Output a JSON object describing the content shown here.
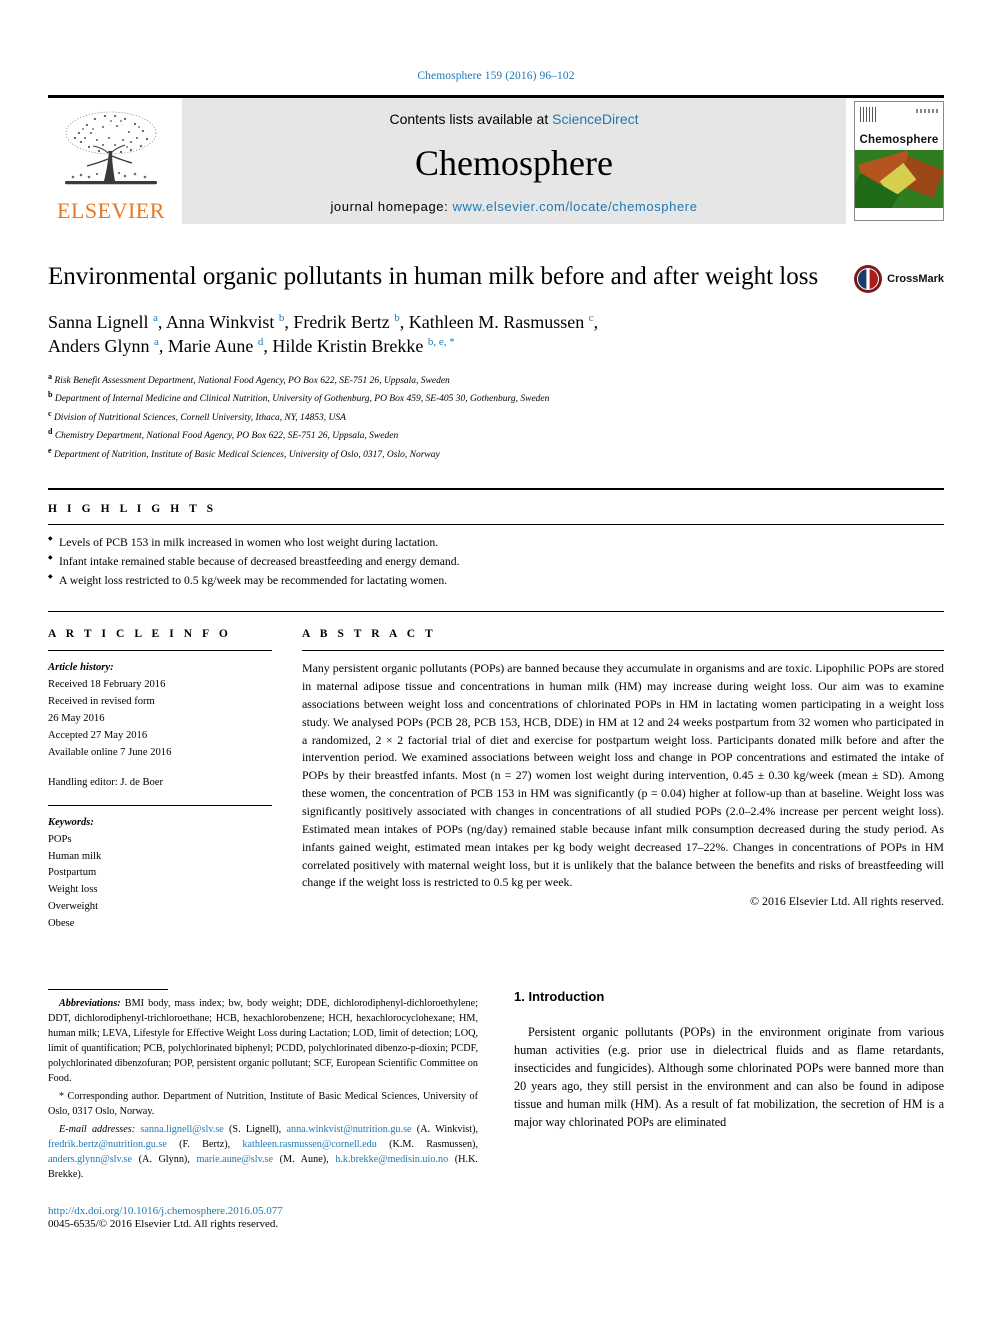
{
  "running_head": "Chemosphere 159 (2016) 96–102",
  "masthead": {
    "publisher": "ELSEVIER",
    "contents_prefix": "Contents lists available at ",
    "contents_link": "ScienceDirect",
    "journal_title": "Chemosphere",
    "homepage_prefix": "journal homepage: ",
    "homepage_url": "www.elsevier.com/locate/chemosphere",
    "cover_journal_name": "Chemosphere"
  },
  "article": {
    "title": "Environmental organic pollutants in human milk before and after weight loss",
    "crossmark_label": "CrossMark",
    "authors_line1": "Sanna Lignell a, Anna Winkvist b, Fredrik Bertz b, Kathleen M. Rasmussen c,",
    "authors_line2": "Anders Glynn a, Marie Aune d, Hilde Kristin Brekke b, e, *",
    "authors": [
      {
        "name": "Sanna Lignell",
        "marks": "a",
        "sep": ", "
      },
      {
        "name": "Anna Winkvist",
        "marks": "b",
        "sep": ", "
      },
      {
        "name": "Fredrik Bertz",
        "marks": "b",
        "sep": ", "
      },
      {
        "name": "Kathleen M. Rasmussen",
        "marks": "c",
        "sep": ","
      },
      {
        "name": "Anders Glynn",
        "marks": "a",
        "sep": ", "
      },
      {
        "name": "Marie Aune",
        "marks": "d",
        "sep": ", "
      },
      {
        "name": "Hilde Kristin Brekke",
        "marks": "b, e, *",
        "sep": ""
      }
    ],
    "affiliations": [
      {
        "mark": "a",
        "text": "Risk Benefit Assessment Department, National Food Agency, PO Box 622, SE-751 26, Uppsala, Sweden"
      },
      {
        "mark": "b",
        "text": "Department of Internal Medicine and Clinical Nutrition, University of Gothenburg, PO Box 459, SE-405 30, Gothenburg, Sweden"
      },
      {
        "mark": "c",
        "text": "Division of Nutritional Sciences, Cornell University, Ithaca, NY, 14853, USA"
      },
      {
        "mark": "d",
        "text": "Chemistry Department, National Food Agency, PO Box 622, SE-751 26, Uppsala, Sweden"
      },
      {
        "mark": "e",
        "text": "Department of Nutrition, Institute of Basic Medical Sciences, University of Oslo, 0317, Oslo, Norway"
      }
    ]
  },
  "highlights": {
    "heading": "H I G H L I G H T S",
    "items": [
      "Levels of PCB 153 in milk increased in women who lost weight during lactation.",
      "Infant intake remained stable because of decreased breastfeeding and energy demand.",
      "A weight loss restricted to 0.5 kg/week may be recommended for lactating women."
    ]
  },
  "article_info": {
    "heading": "A R T I C L E  I N F O",
    "history_label": "Article history:",
    "history": [
      "Received 18 February 2016",
      "Received in revised form",
      "26 May 2016",
      "Accepted 27 May 2016",
      "Available online 7 June 2016"
    ],
    "handling_editor": "Handling editor: J. de Boer",
    "keywords_label": "Keywords:",
    "keywords": [
      "POPs",
      "Human milk",
      "Postpartum",
      "Weight loss",
      "Overweight",
      "Obese"
    ]
  },
  "abstract": {
    "heading": "A B S T R A C T",
    "body": "Many persistent organic pollutants (POPs) are banned because they accumulate in organisms and are toxic. Lipophilic POPs are stored in maternal adipose tissue and concentrations in human milk (HM) may increase during weight loss. Our aim was to examine associations between weight loss and concentrations of chlorinated POPs in HM in lactating women participating in a weight loss study. We analysed POPs (PCB 28, PCB 153, HCB, DDE) in HM at 12 and 24 weeks postpartum from 32 women who participated in a randomized, 2 × 2 factorial trial of diet and exercise for postpartum weight loss. Participants donated milk before and after the intervention period. We examined associations between weight loss and change in POP concentrations and estimated the intake of POPs by their breastfed infants. Most (n = 27) women lost weight during intervention, 0.45 ± 0.30 kg/week (mean ± SD). Among these women, the concentration of PCB 153 in HM was significantly (p = 0.04) higher at follow-up than at baseline. Weight loss was significantly positively associated with changes in concentrations of all studied POPs (2.0–2.4% increase per percent weight loss). Estimated mean intakes of POPs (ng/day) remained stable because infant milk consumption decreased during the study period. As infants gained weight, estimated mean intakes per kg body weight decreased 17–22%. Changes in concentrations of POPs in HM correlated positively with maternal weight loss, but it is unlikely that the balance between the benefits and risks of breastfeeding will change if the weight loss is restricted to 0.5 kg per week.",
    "copyright": "© 2016 Elsevier Ltd. All rights reserved."
  },
  "footnotes": {
    "abbreviations_label": "Abbreviations:",
    "abbreviations_text": " BMI body, mass index; bw, body weight; DDE, dichlorodiphenyl-dichloroethylene; DDT, dichlorodiphenyl-trichloroethane; HCB, hexachlorobenzene; HCH, hexachlorocyclohexane; HM, human milk; LEVA, Lifestyle for Effective Weight Loss during Lactation; LOD, limit of detection; LOQ, limit of quantification; PCB, polychlorinated biphenyl; PCDD, polychlorinated dibenzo-p-dioxin; PCDF, polychlorinated dibenzofuran; POP, persistent organic pollutant; SCF, European Scientific Committee on Food.",
    "corresponding_marker": "*",
    "corresponding_text": " Corresponding author. Department of Nutrition, Institute of Basic Medical Sciences, University of Oslo, 0317 Oslo, Norway.",
    "email_label": "E-mail addresses:",
    "emails": [
      {
        "address": "sanna.lignell@slv.se",
        "owner": " (S. Lignell), "
      },
      {
        "address": "anna.winkvist@nutrition.gu.se",
        "owner": " (A. Winkvist), "
      },
      {
        "address": "fredrik.bertz@nutrition.gu.se",
        "owner": " (F. Bertz), "
      },
      {
        "address": "kathleen.rasmussen@cornell.edu",
        "owner": " (K.M. Rasmussen), "
      },
      {
        "address": "anders.glynn@slv.se",
        "owner": " (A. Glynn), "
      },
      {
        "address": "marie.aune@slv.se",
        "owner": " (M. Aune), "
      },
      {
        "address": "h.k.brekke@medisin.uio.no",
        "owner": " (H.K. Brekke)."
      }
    ],
    "doi": "http://dx.doi.org/10.1016/j.chemosphere.2016.05.077",
    "issn_line": "0045-6535/© 2016 Elsevier Ltd. All rights reserved."
  },
  "introduction": {
    "heading": "1. Introduction",
    "paragraph": "Persistent organic pollutants (POPs) in the environment originate from various human activities (e.g. prior use in dielectrical fluids and as flame retardants, insecticides and fungicides). Although some chlorinated POPs were banned more than 20 years ago, they still persist in the environment and can also be found in adipose tissue and human milk (HM). As a result of fat mobilization, the secretion of HM is a major way chlorinated POPs are eliminated"
  },
  "colors": {
    "link": "#1f78b4",
    "elsevier_orange": "#e87722",
    "masthead_grey": "#e6e6e6"
  }
}
